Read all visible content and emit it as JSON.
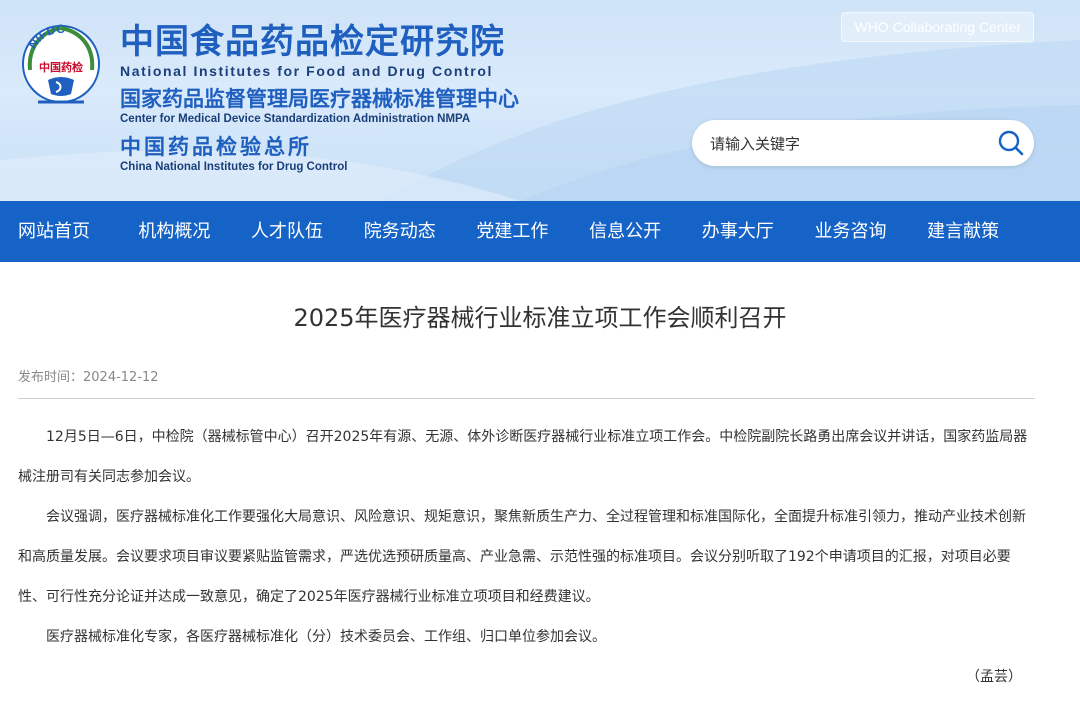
{
  "header": {
    "logo": {
      "arc_text": "NIFDC",
      "center_text": "中国药检"
    },
    "brand": {
      "cn_main": "中国食品药品检定研究院",
      "en_main": "National Institutes for Food and Drug Control",
      "cn_sub": "国家药品监督管理局医疗器械标准管理中心",
      "en_sub": "Center for Medical Device Standardization Administration NMPA",
      "cn_sub2": "中国药品检验总所",
      "en_sub2": "China National Institutes for Drug Control"
    },
    "who_label": "WHO Collaborating Center",
    "search": {
      "placeholder": "请输入关键字",
      "icon": "search-icon"
    }
  },
  "nav": {
    "items": [
      {
        "label": "网站首页"
      },
      {
        "label": "机构概况"
      },
      {
        "label": "人才队伍"
      },
      {
        "label": "院务动态"
      },
      {
        "label": "党建工作"
      },
      {
        "label": "信息公开"
      },
      {
        "label": "办事大厅"
      },
      {
        "label": "业务咨询"
      },
      {
        "label": "建言献策"
      }
    ]
  },
  "article": {
    "title": "2025年医疗器械行业标准立项工作会顺利召开",
    "publish_label": "发布时间：2024-12-12",
    "paragraphs": [
      "12月5日—6日，中检院（器械标管中心）召开2025年有源、无源、体外诊断医疗器械行业标准立项工作会。中检院副院长路勇出席会议并讲话，国家药监局器械注册司有关同志参加会议。",
      "会议强调，医疗器械标准化工作要强化大局意识、风险意识、规矩意识，聚焦新质生产力、全过程管理和标准国际化，全面提升标准引领力，推动产业技术创新和高质量发展。会议要求项目审议要紧贴监管需求，严选优选预研质量高、产业急需、示范性强的标准项目。会议分别听取了192个申请项目的汇报，对项目必要性、可行性充分论证并达成一致意见，确定了2025年医疗器械行业标准立项项目和经费建议。",
      "医疗器械标准化专家，各医疗器械标准化（分）技术委员会、工作组、归口单位参加会议。"
    ],
    "author": "（孟芸）"
  },
  "colors": {
    "nav_bg": "#1663c7",
    "brand_blue": "#1f5fbf",
    "header_bg": "#d4e7f9"
  }
}
